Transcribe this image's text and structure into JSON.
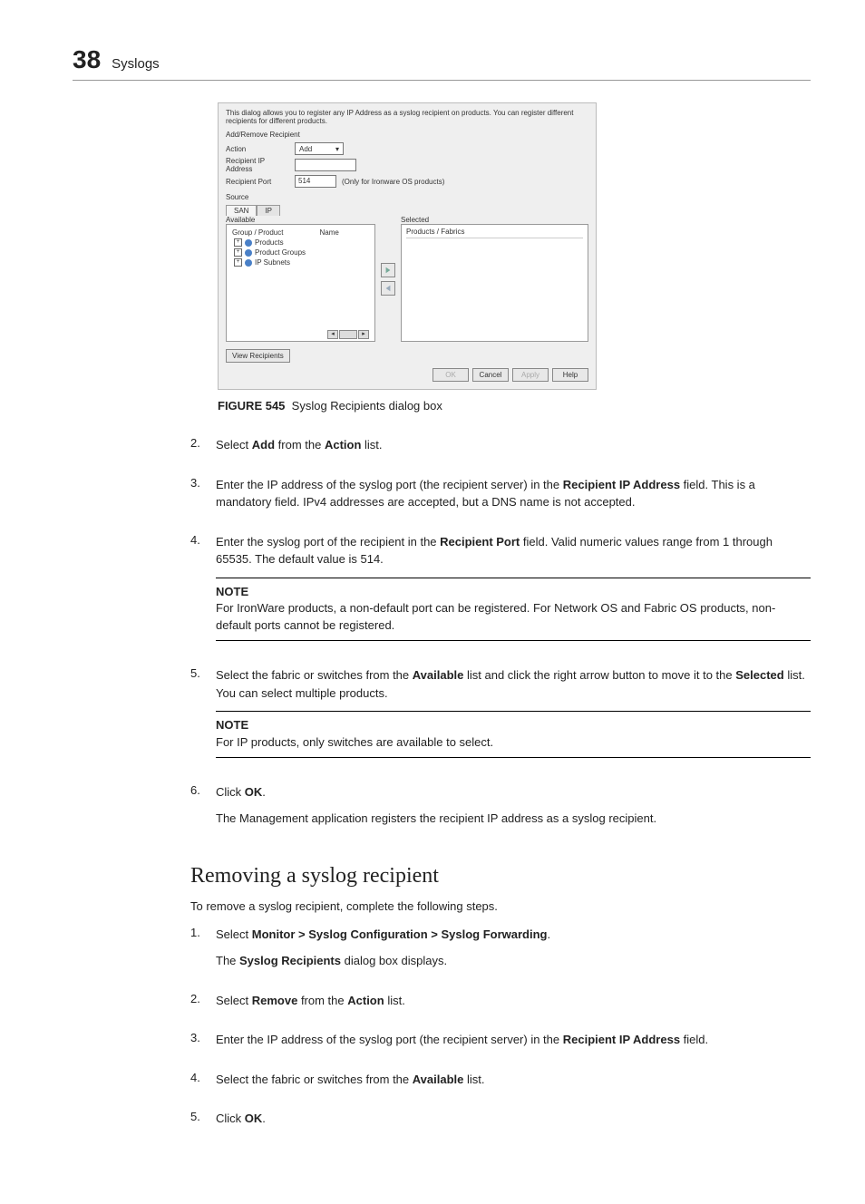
{
  "header": {
    "pageNumber": "38",
    "title": "Syslogs"
  },
  "screenshot": {
    "intro": "This dialog allows you to register any IP Address as a syslog recipient on products. You can register different recipients for different products.",
    "sectionTitle": "Add/Remove Recipient",
    "actionLabel": "Action",
    "actionValue": "Add",
    "ipLabel": "Recipient IP Address",
    "portLabel": "Recipient Port",
    "portValue": "514",
    "portNote": "(Only for Ironware OS products)",
    "sourceLabel": "Source",
    "tabs": {
      "san": "SAN",
      "ip": "IP"
    },
    "available": {
      "title": "Available",
      "col1": "Group / Product",
      "col2": "Name",
      "items": [
        "Products",
        "Product Groups",
        "IP Subnets"
      ]
    },
    "selected": {
      "title": "Selected",
      "col": "Products / Fabrics"
    },
    "viewRecipients": "View Recipients",
    "buttons": {
      "ok": "OK",
      "cancel": "Cancel",
      "apply": "Apply",
      "help": "Help"
    }
  },
  "figure": {
    "label": "FIGURE 545",
    "caption": "Syslog Recipients dialog box"
  },
  "steps": {
    "s2": {
      "num": "2.",
      "pre": "Select ",
      "b1": "Add",
      "mid": " from the ",
      "b2": "Action",
      "post": " list."
    },
    "s3": {
      "num": "3.",
      "pre": "Enter the IP address of the syslog port (the recipient server) in the ",
      "b1": "Recipient IP Address",
      "post": " field. This is a mandatory field. IPv4 addresses are accepted, but a DNS name is not accepted."
    },
    "s4": {
      "num": "4.",
      "pre": "Enter the syslog port of the recipient in the ",
      "b1": "Recipient Port",
      "post": " field. Valid numeric values range from 1 through 65535. The default value is 514."
    },
    "s5": {
      "num": "5.",
      "pre": "Select the fabric or switches from the ",
      "b1": "Available",
      "mid": " list and click the right arrow button to move it to the ",
      "b2": "Selected",
      "post": " list. You can select multiple products."
    },
    "s6": {
      "num": "6.",
      "pre": "Click ",
      "b1": "OK",
      "post": ".",
      "para2": "The Management application registers the recipient IP address as a syslog recipient."
    }
  },
  "note1": {
    "title": "NOTE",
    "text": "For IronWare products, a non-default port can be registered. For Network OS and Fabric OS products, non-default ports cannot be registered."
  },
  "note2": {
    "title": "NOTE",
    "text": "For IP products, only switches are available to select."
  },
  "section2": {
    "heading": "Removing a syslog recipient",
    "lead": "To remove a syslog recipient, complete the following steps.",
    "s1": {
      "num": "1.",
      "pre": "Select ",
      "b1": "Monitor > Syslog Configuration > Syslog Forwarding",
      "post": ".",
      "para2pre": "The ",
      "para2b": "Syslog Recipients",
      "para2post": " dialog box displays."
    },
    "s2": {
      "num": "2.",
      "pre": "Select ",
      "b1": "Remove",
      "mid": " from the ",
      "b2": "Action",
      "post": " list."
    },
    "s3": {
      "num": "3.",
      "pre": "Enter the IP address of the syslog port (the recipient server) in the ",
      "b1": "Recipient IP Address",
      "post": " field."
    },
    "s4": {
      "num": "4.",
      "pre": "Select the fabric or switches from the ",
      "b1": "Available",
      "post": " list."
    },
    "s5": {
      "num": "5.",
      "pre": "Click ",
      "b1": "OK",
      "post": "."
    }
  }
}
